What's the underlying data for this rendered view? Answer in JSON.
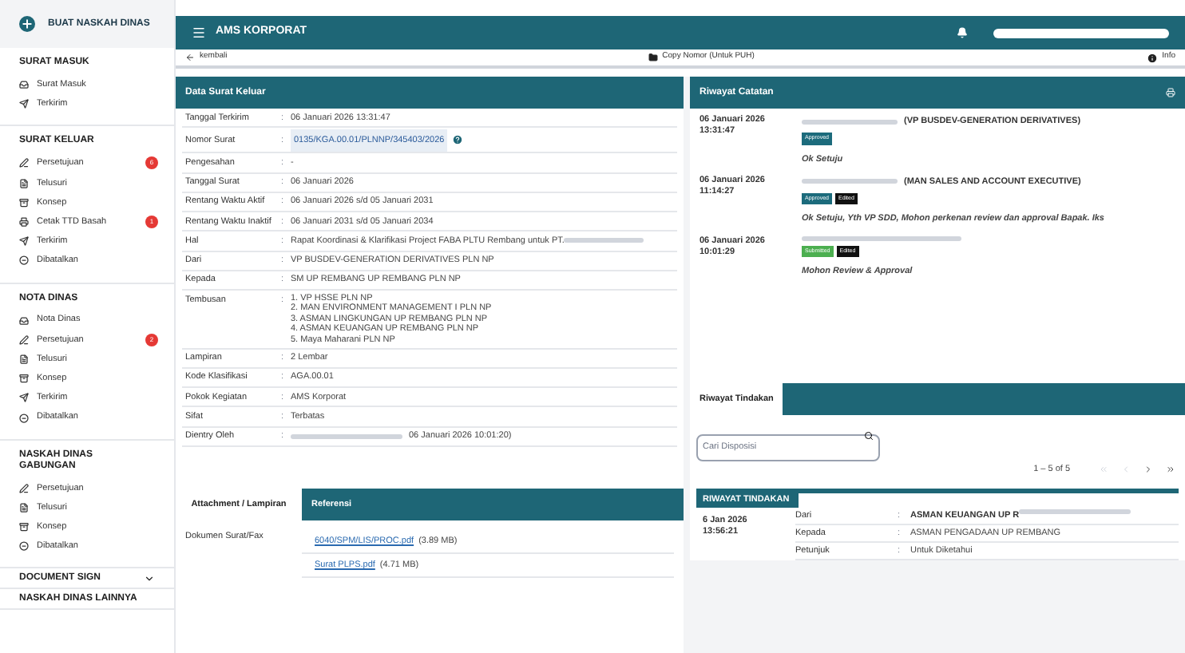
{
  "sidebar": {
    "create_button": "BUAT NASKAH DINAS",
    "sections": [
      {
        "title": "SURAT MASUK",
        "items": [
          {
            "label": "Surat Masuk",
            "kind": "inbox"
          },
          {
            "label": "Terkirim",
            "kind": "send"
          }
        ]
      },
      {
        "title": "SURAT KELUAR",
        "items": [
          {
            "label": "Persetujuan",
            "kind": "pen",
            "badge": "6"
          },
          {
            "label": "Telusuri",
            "kind": "file"
          },
          {
            "label": "Konsep",
            "kind": "tray"
          },
          {
            "label": "Cetak TTD Basah",
            "kind": "print",
            "badge": "1"
          },
          {
            "label": "Terkirim",
            "kind": "send"
          },
          {
            "label": "Dibatalkan",
            "kind": "cancel"
          }
        ]
      },
      {
        "title": "NOTA DINAS",
        "items": [
          {
            "label": "Nota Dinas",
            "kind": "inbox"
          },
          {
            "label": "Persetujuan",
            "kind": "pen",
            "badge": "2"
          },
          {
            "label": "Telusuri",
            "kind": "file"
          },
          {
            "label": "Konsep",
            "kind": "tray"
          },
          {
            "label": "Terkirim",
            "kind": "send"
          },
          {
            "label": "Dibatalkan",
            "kind": "cancel"
          }
        ]
      },
      {
        "title": "NASKAH DINAS GABUNGAN",
        "items": [
          {
            "label": "Persetujuan",
            "kind": "pen"
          },
          {
            "label": "Telusuri",
            "kind": "file"
          },
          {
            "label": "Konsep",
            "kind": "tray"
          },
          {
            "label": "Dibatalkan",
            "kind": "cancel"
          }
        ]
      }
    ],
    "collapsed": [
      {
        "title": "DOCUMENT SIGN",
        "expanded": false
      },
      {
        "title": "NASKAH DINAS LAINNYA"
      }
    ]
  },
  "header": {
    "title": "AMS KORPORAT"
  },
  "toolbar": {
    "back": "kembali",
    "copy": "Copy Nomor (Untuk PUH)",
    "info": "Info"
  },
  "detail": {
    "title": "Data Surat Keluar",
    "separator": ":",
    "rows": [
      {
        "label": "Tanggal Terkirim",
        "value": "06 Januari 2026 13:31:47"
      },
      {
        "label": "Nomor Surat",
        "value": "0135/KGA.00.01/PLNNP/345403/2026",
        "kind": "number"
      },
      {
        "label": "Pengesahan",
        "value": "-"
      },
      {
        "label": "Tanggal Surat",
        "value": "06 Januari 2026"
      },
      {
        "label": "Rentang Waktu Aktif",
        "value": "06 Januari 2026 s/d 05 Januari 2031"
      },
      {
        "label": "Rentang Waktu Inaktif",
        "value": "06 Januari 2031 s/d 05 Januari 2034"
      },
      {
        "label": "Hal",
        "value": "Rapat Koordinasi & Klarifikasi Project FABA PLTU Rembang untuk PT.",
        "kind": "redacted"
      },
      {
        "label": "Dari",
        "value": "VP BUSDEV-GENERATION DERIVATIVES PLN NP"
      },
      {
        "label": "Kepada",
        "value": "SM UP REMBANG UP REMBANG PLN NP"
      },
      {
        "label": "Tembusan",
        "lines": [
          "1. VP HSSE PLN NP",
          "2. MAN ENVIRONMENT MANAGEMENT I PLN NP",
          "3. ASMAN LINGKUNGAN UP REMBANG PLN NP",
          "4. ASMAN KEUANGAN UP REMBANG PLN NP",
          "5. Maya Maharani PLN NP"
        ]
      },
      {
        "label": "Lampiran",
        "value": "2 Lembar"
      },
      {
        "label": "Kode Klasifikasi",
        "value": "AGA.00.01"
      },
      {
        "label": "Pokok Kegiatan",
        "value": "AMS Korporat"
      },
      {
        "label": "Sifat",
        "value": "Terbatas"
      },
      {
        "label": "Dientry Oleh",
        "value": "06 Januari 2026 10:01:20)",
        "kind": "redacted"
      }
    ]
  },
  "notes": {
    "title": "Riwayat Catatan",
    "entries": [
      {
        "date": "06 Januari 2026",
        "time": "13:31:47",
        "author": "(VP BUSDEV-GENERATION DERIVATIVES)",
        "tags": [
          {
            "label": "Approved",
            "color": "#1c6b7c"
          }
        ],
        "note": "Ok Setuju"
      },
      {
        "date": "06 Januari 2026",
        "time": "11:14:27",
        "author": "(MAN SALES AND ACCOUNT EXECUTIVE)",
        "tags": [
          {
            "label": "Approved",
            "color": "#1c6b7c"
          },
          {
            "label": "Edited",
            "color": "#111111"
          }
        ],
        "note": "Ok Setuju, Yth VP SDD, Mohon perkenan review dan approval Bapak. Iks"
      },
      {
        "date": "06 Januari 2026",
        "time": "10:01:29",
        "tags": [
          {
            "label": "Submitted",
            "color": "#4caf50"
          },
          {
            "label": "Edited",
            "color": "#111111"
          }
        ],
        "note": "Mohon Review & Approval"
      }
    ]
  },
  "attachments": {
    "tabs": [
      {
        "label": "Attachment / Lampiran",
        "selected": true
      },
      {
        "label": "Referensi",
        "selected": false
      }
    ],
    "label": "Dokumen Surat/Fax",
    "files": [
      {
        "name": "6040/SPM/LIS/PROC.pdf",
        "size": "(3.89 MB)"
      },
      {
        "name": "Surat PLPS.pdf",
        "size": "(4.71 MB)"
      }
    ]
  },
  "actions": {
    "tabs": [
      {
        "label": "Riwayat Tindakan",
        "selected": true
      }
    ],
    "search": {
      "placeholder": "Cari Disposisi"
    },
    "pagination": "1 – 5 of 5",
    "table_title": "RIWAYAT TINDAKAN",
    "separator": ":",
    "rows": [
      {
        "date": "6 Jan 2026",
        "time": "13:56:21",
        "fields": [
          {
            "label": "Dari",
            "value": "ASMAN KEUANGAN UP R"
          },
          {
            "label": "Kepada",
            "value": "ASMAN PENGADAAN UP REMBANG"
          },
          {
            "label": "Petunjuk",
            "value": "Untuk Diketahui"
          }
        ]
      }
    ]
  }
}
